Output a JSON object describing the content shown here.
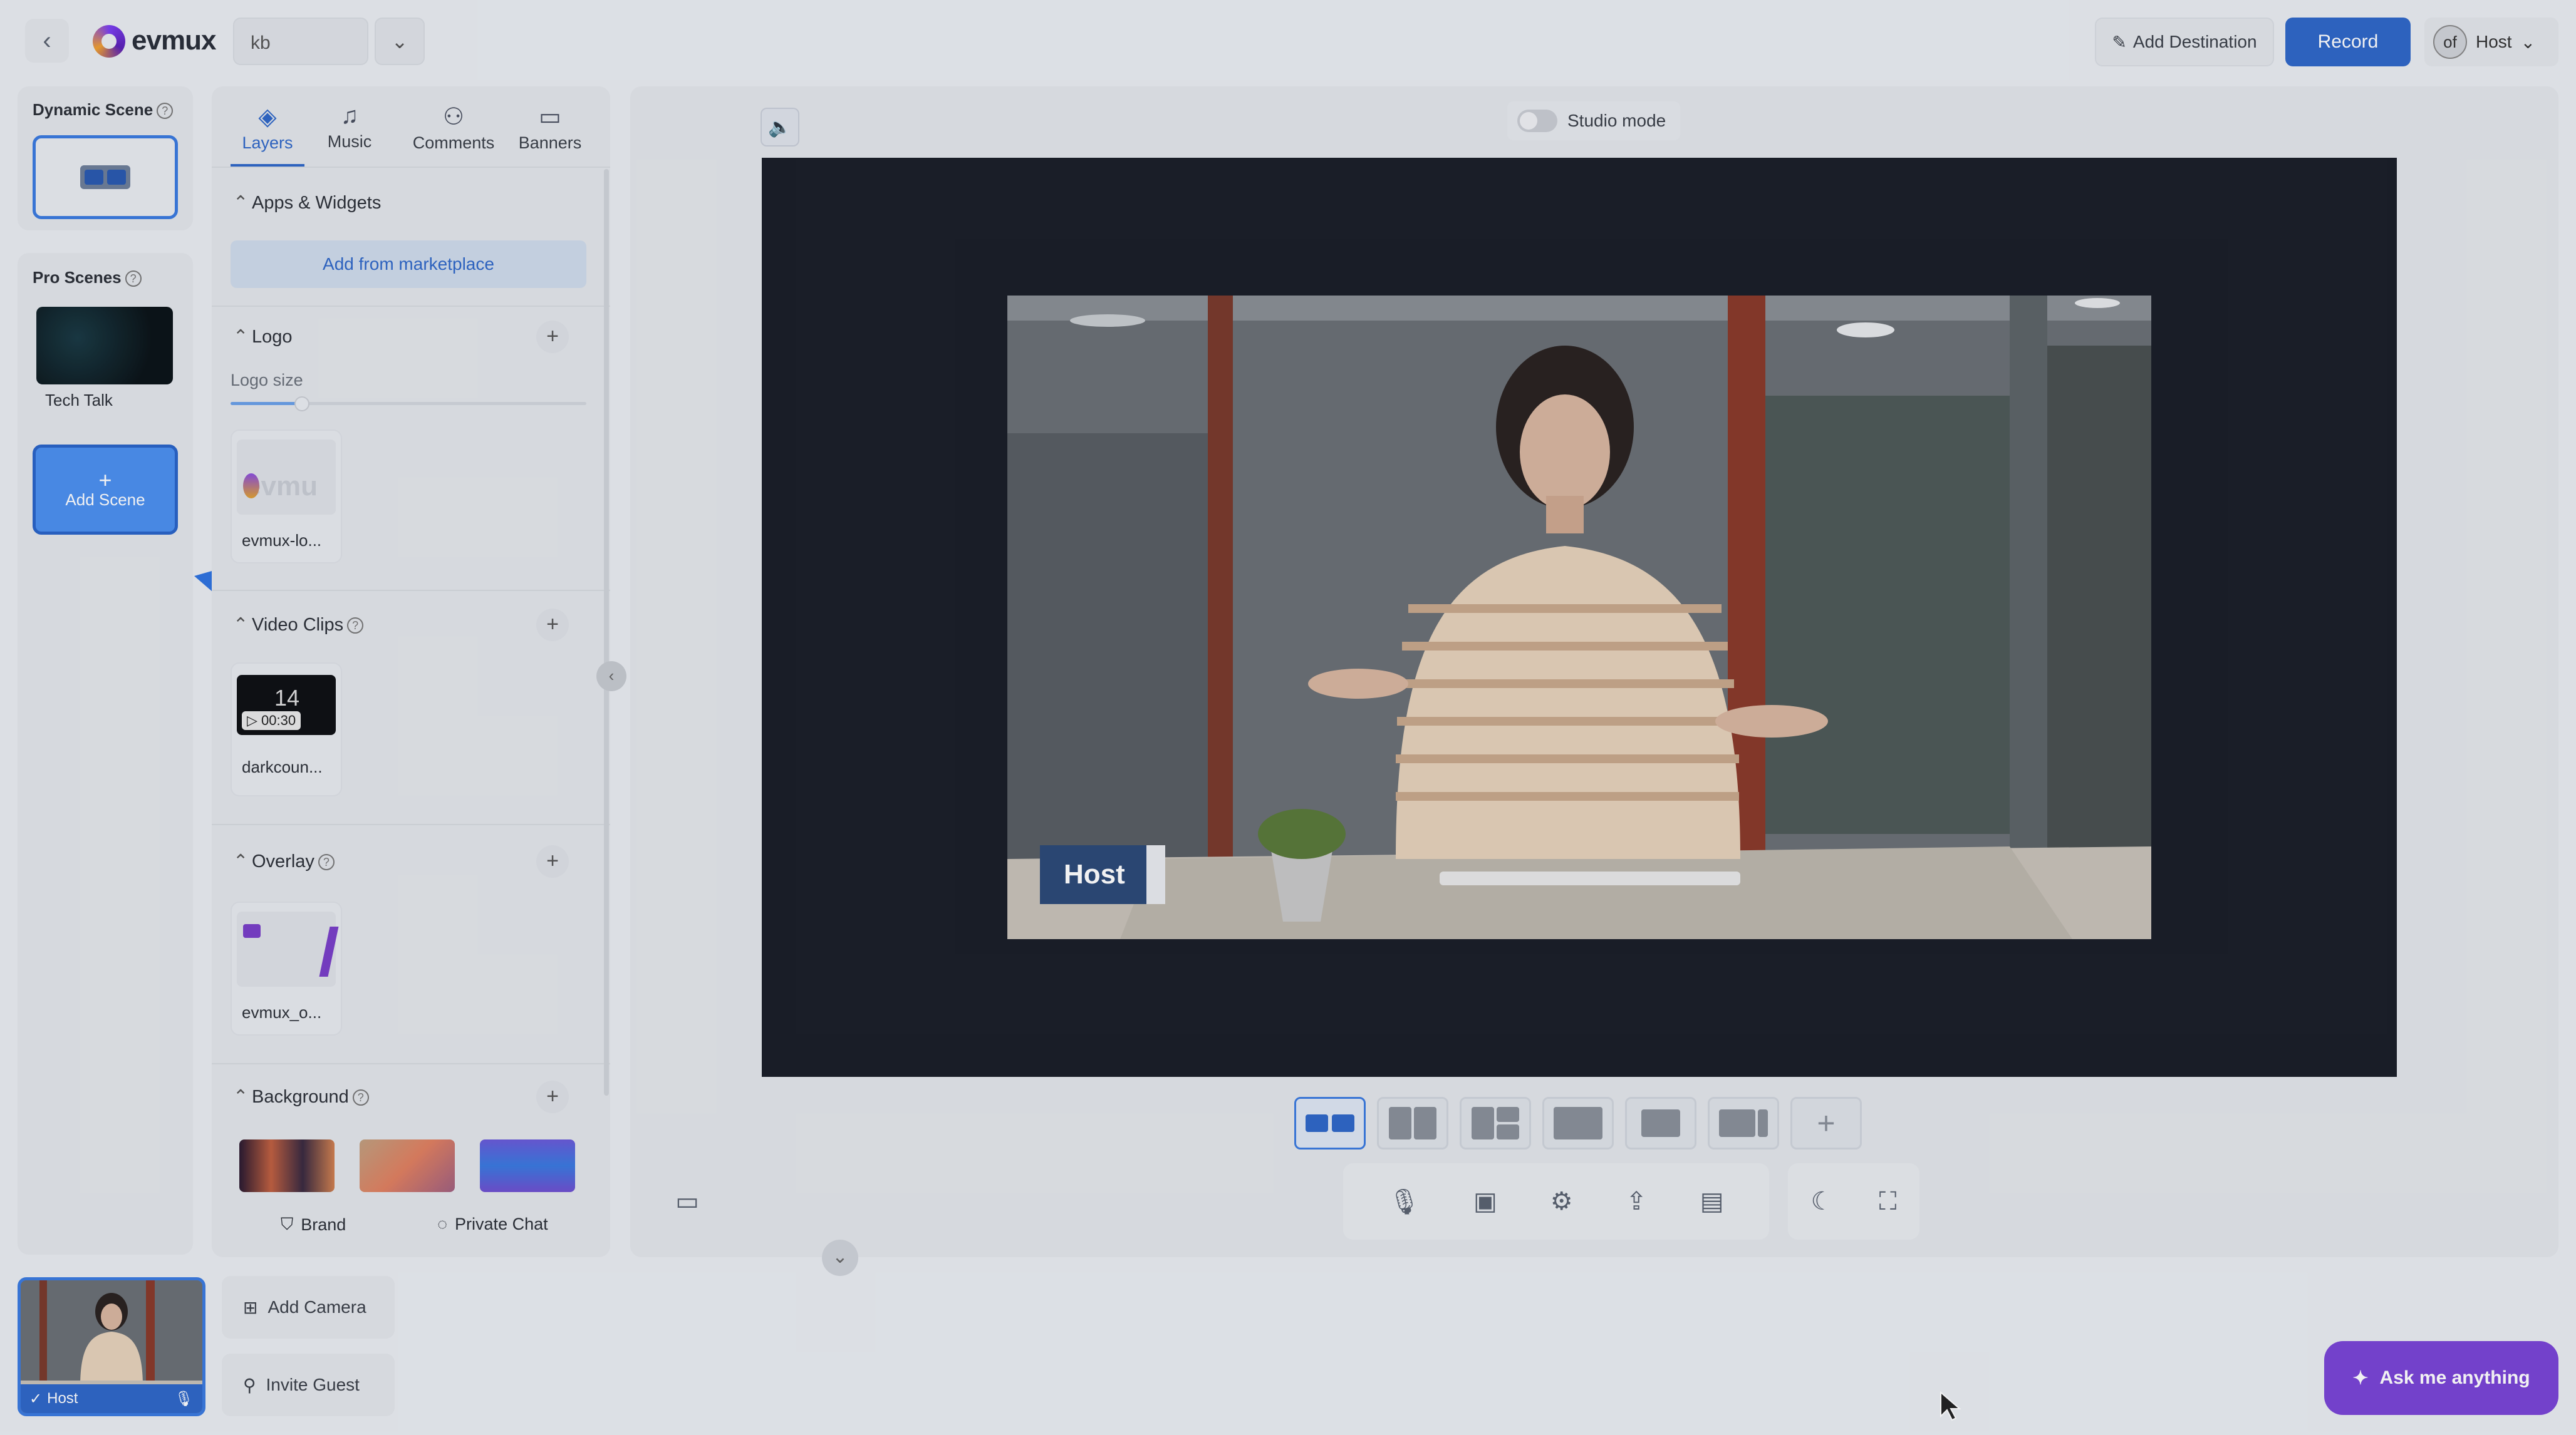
{
  "header": {
    "back_icon": "chevron-left-icon",
    "brand": "evmux",
    "room_value": "kb",
    "add_destination": "Add Destination",
    "record": "Record",
    "avatar_text": "of",
    "user_label": "Host"
  },
  "scenes": {
    "dynamic_title": "Dynamic Scene",
    "pro_title": "Pro Scenes",
    "pro_items": [
      {
        "label": "Tech Talk"
      }
    ],
    "add_scene_plus": "+",
    "add_scene": "Add Scene"
  },
  "panel": {
    "tabs": [
      {
        "label": "Layers",
        "icon": "layers-icon",
        "glyph": "◈"
      },
      {
        "label": "Music",
        "icon": "music-icon",
        "glyph": "♫"
      },
      {
        "label": "Comments",
        "icon": "comments-icon",
        "glyph": "⚇"
      },
      {
        "label": "Banners",
        "icon": "banner-icon",
        "glyph": "▭"
      }
    ],
    "apps_title": "Apps & Widgets",
    "marketplace_btn": "Add from marketplace",
    "logo_title": "Logo",
    "logo_size_label": "Logo size",
    "logo_size_value": 0.2,
    "logo_asset": "evmux-lo...",
    "logo_thumb_text": "evmu",
    "video_title": "Video Clips",
    "video_asset": "darkcoun...",
    "video_duration": "00:30",
    "video_thumb_text": "14",
    "overlay_title": "Overlay",
    "overlay_asset": "evmux_o...",
    "background_title": "Background",
    "footer_brand": "Brand",
    "footer_chat": "Private Chat"
  },
  "stage": {
    "studio_mode": "Studio mode",
    "host_name_tag": "Host",
    "active_layout": 0
  },
  "bottom": {
    "host_label": "Host",
    "add_camera": "Add Camera",
    "invite_guest": "Invite Guest",
    "ask": "Ask me anything"
  },
  "colors": {
    "accent": "#2f68c8",
    "ask_button": "#7a45d6",
    "stage_bg": "#1a1e28",
    "name_tag": "#2c4a78"
  }
}
